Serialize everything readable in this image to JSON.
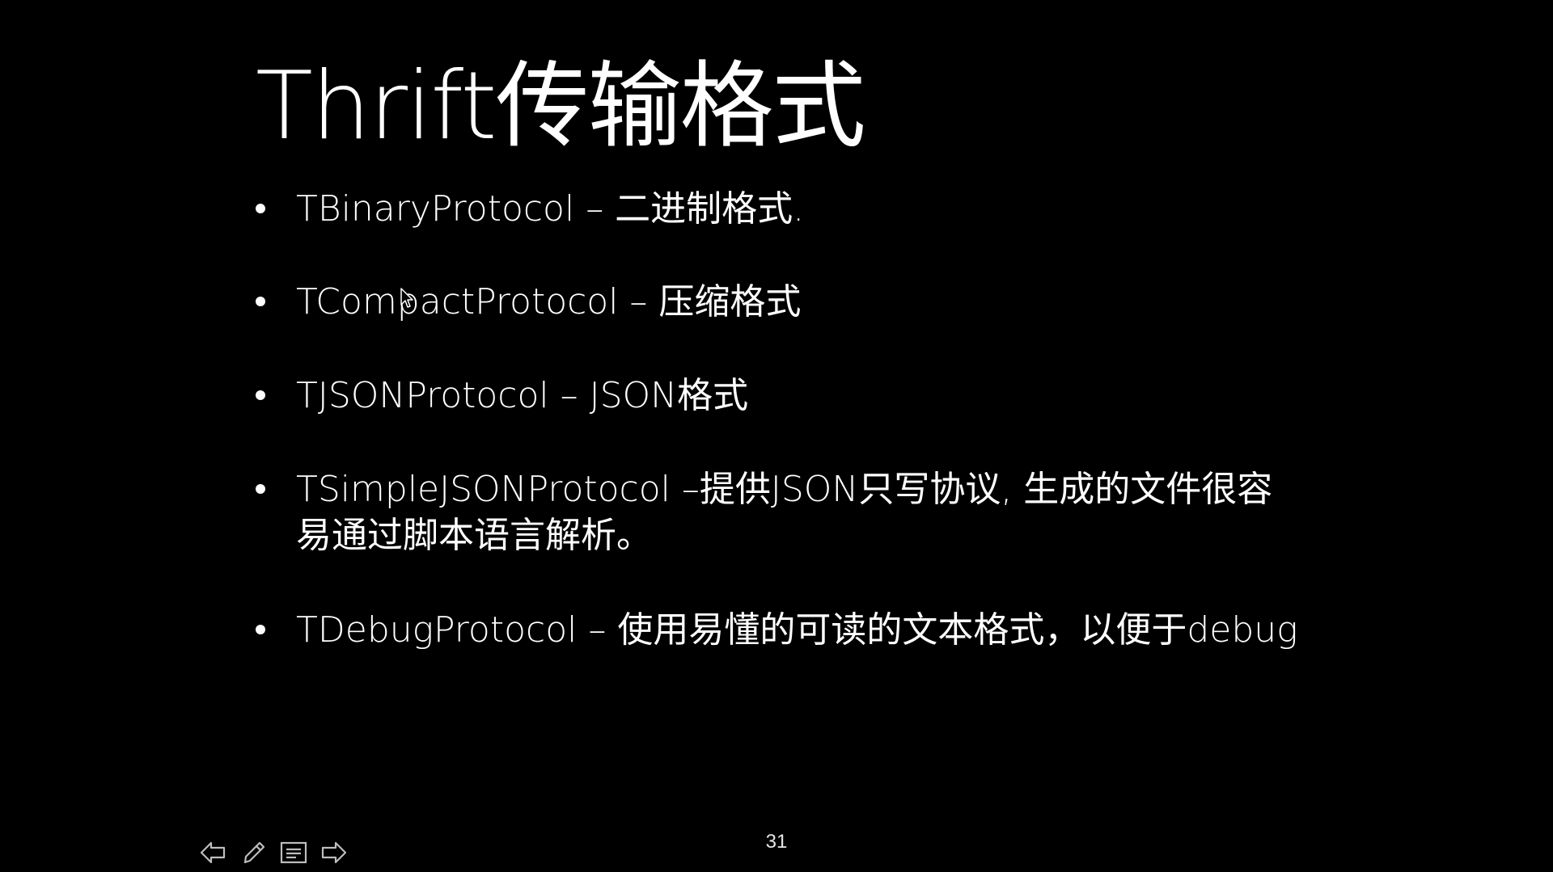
{
  "slide": {
    "title": "Thrift传输格式",
    "bullets": [
      {
        "text": "TBinaryProtocol – 二进制格式."
      },
      {
        "text": "TCompactProtocol – 压缩格式"
      },
      {
        "text": "TJSONProtocol – JSON格式"
      },
      {
        "text": "TSimpleJSONProtocol –提供JSON只写协议, 生成的文件很容易通过脚本语言解析。"
      },
      {
        "text": "TDebugProtocol – 使用易懂的可读的文本格式，以便于debug"
      }
    ],
    "page_number": "31"
  },
  "toolbar": {
    "icons": [
      "previous-arrow-icon",
      "pencil-icon",
      "slide-list-icon",
      "next-arrow-icon"
    ]
  },
  "colors": {
    "background": "#000000",
    "text": "#ffffff",
    "toolbar_icon": "#bdbdbd"
  }
}
